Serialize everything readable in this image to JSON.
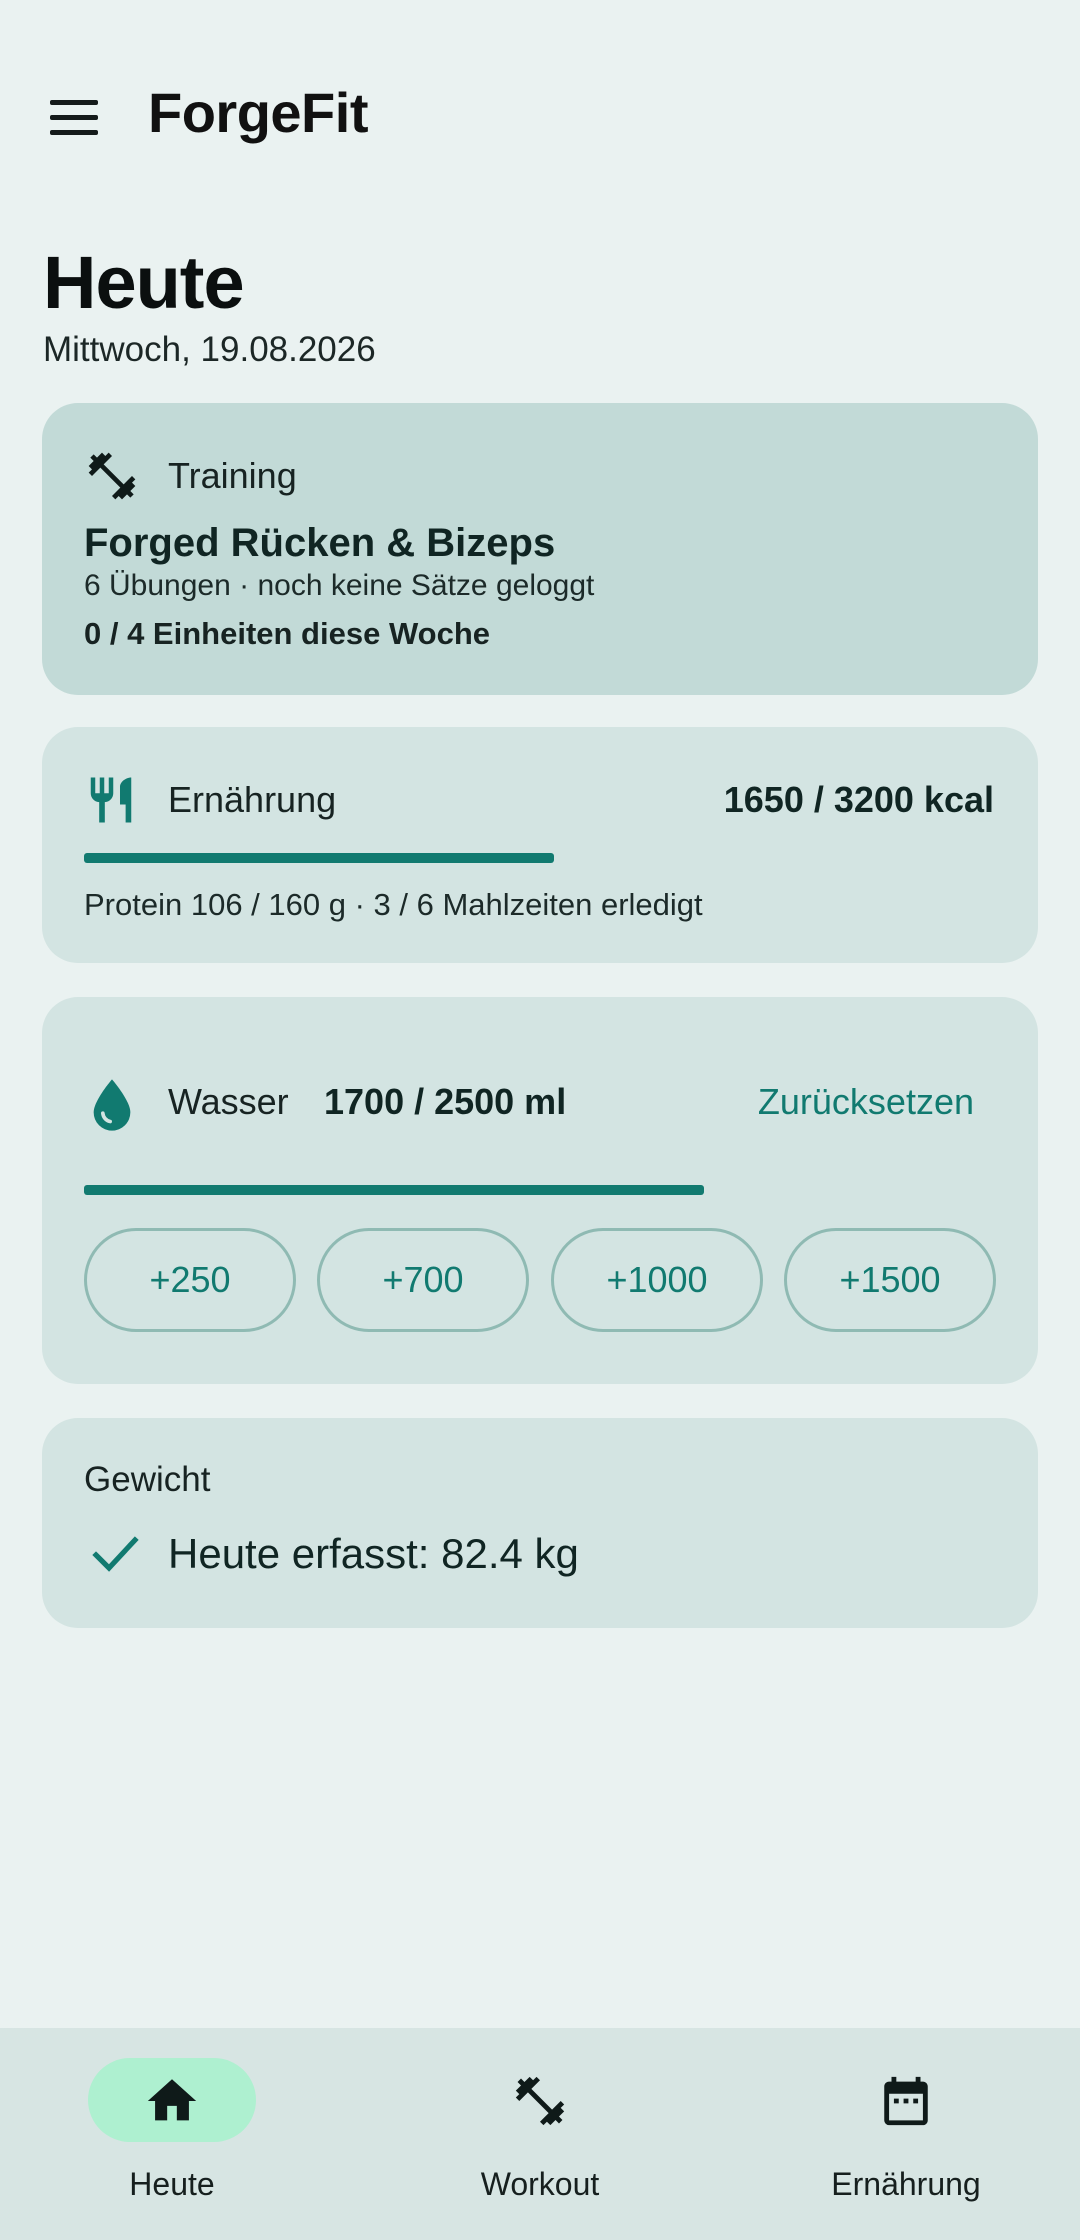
{
  "app": {
    "title": "ForgeFit"
  },
  "header": {
    "menu_icon": "menu-icon"
  },
  "page": {
    "title": "Heute",
    "date": "Mittwoch, 19.08.2026"
  },
  "training": {
    "icon": "dumbbell-icon",
    "label": "Training",
    "workout_name": "Forged Rücken & Bizeps",
    "summary": "6 Übungen · noch keine Sätze geloggt",
    "weekly": "0 / 4 Einheiten diese Woche"
  },
  "nutrition": {
    "icon": "restaurant-icon",
    "label": "Ernährung",
    "calories": "1650 / 3200 kcal",
    "progress": 0.5156,
    "summary": "Protein 106 / 160 g · 3 / 6 Mahlzeiten erledigt"
  },
  "water": {
    "icon": "water-drop-icon",
    "label": "Wasser",
    "amount": "1700 / 2500 ml",
    "progress": 0.68,
    "reset_label": "Zurücksetzen",
    "chips": [
      "+250",
      "+700",
      "+1000",
      "+1500"
    ]
  },
  "weight": {
    "label": "Gewicht",
    "icon": "check-icon",
    "value": "Heute erfasst: 82.4 kg"
  },
  "bottom_nav": {
    "items": [
      {
        "label": "Heute",
        "icon": "home-icon",
        "active": true
      },
      {
        "label": "Workout",
        "icon": "dumbbell-icon",
        "active": false
      },
      {
        "label": "Ernährung",
        "icon": "calendar-icon",
        "active": false
      }
    ]
  },
  "colors": {
    "background": "#eaf2f1",
    "accent": "#117a70",
    "training_card": "#c2dad7",
    "card": "#d3e4e2",
    "nav_active_pill": "#aef0d0"
  }
}
